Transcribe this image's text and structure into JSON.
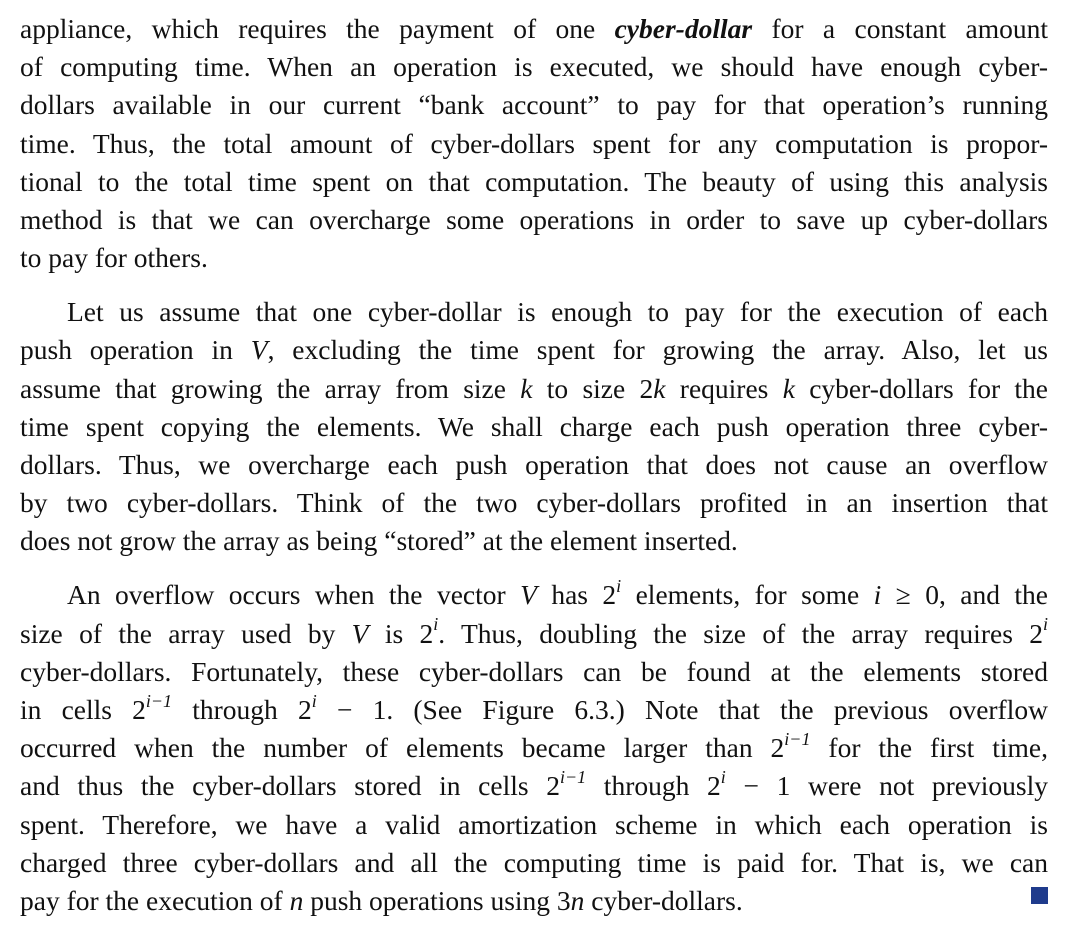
{
  "paragraph1": {
    "line1_a": "appliance, which requires the payment of one ",
    "line1_term": "cyber-dollar",
    "line1_b": " for a constant amount",
    "line2": "of computing time. When an operation is executed, we should have enough cyber-",
    "line3": "dollars available in our current “bank account” to pay for that operation’s running",
    "line4": "time. Thus, the total amount of cyber-dollars spent for any computation is propor-",
    "line5": "tional to the total time spent on that computation. The beauty of using this analysis",
    "line6": "method is that we can overcharge some operations in order to save up cyber-dollars",
    "line7": "to pay for others."
  },
  "paragraph2": {
    "line1": "Let us assume that one cyber-dollar is enough to pay for the execution of each",
    "line2_a": "push operation in ",
    "line2_var": "V",
    "line2_b": ", excluding the time spent for growing the array.  Also, let us",
    "line3_a": "assume that growing the array from size ",
    "line3_k": "k",
    "line3_b": " to size 2",
    "line3_k2": "k",
    "line3_c": " requires ",
    "line3_k3": "k",
    "line3_d": " cyber-dollars for the",
    "line4": "time spent copying the elements. We shall charge each push operation three cyber-",
    "line5": "dollars. Thus, we overcharge each push operation that does not cause an overflow",
    "line6": "by two cyber-dollars.  Think of the two cyber-dollars profited in an insertion that",
    "line7": "does not grow the array as being “stored” at the element inserted."
  },
  "paragraph3": {
    "line1_a": "An overflow occurs when the vector ",
    "line1_v": "V",
    "line1_b": " has 2",
    "line1_sup": "i",
    "line1_c": " elements, for some ",
    "line1_i": "i",
    "line1_d": " ≥ 0, and the",
    "line2_a": "size of the array used by ",
    "line2_v": "V",
    "line2_b": " is 2",
    "line2_sup": "i",
    "line2_c": ".  Thus, doubling the size of the array requires 2",
    "line2_sup2": "i",
    "line3": "cyber-dollars. Fortunately, these cyber-dollars can be found at the elements stored",
    "line4_a": "in cells 2",
    "line4_sup": "i−1",
    "line4_b": " through 2",
    "line4_sup2": "i",
    "line4_c": " − 1.  (See Figure 6.3.)  Note that the previous overflow",
    "line5_a": "occurred when the number of elements became larger than 2",
    "line5_sup": "i−1",
    "line5_b": " for the first time,",
    "line6_a": "and thus the cyber-dollars stored in cells 2",
    "line6_sup": "i−1",
    "line6_b": " through 2",
    "line6_sup2": "i",
    "line6_c": " − 1 were not previously",
    "line7": "spent.  Therefore, we have a valid amortization scheme in which each operation is",
    "line8": "charged three cyber-dollars and all the computing time is paid for. That is, we can",
    "line9_a": "pay for the execution of ",
    "line9_n": "n",
    "line9_b": " push operations using 3",
    "line9_n2": "n",
    "line9_c": " cyber-dollars."
  },
  "qed_color": "#1f3b8c"
}
